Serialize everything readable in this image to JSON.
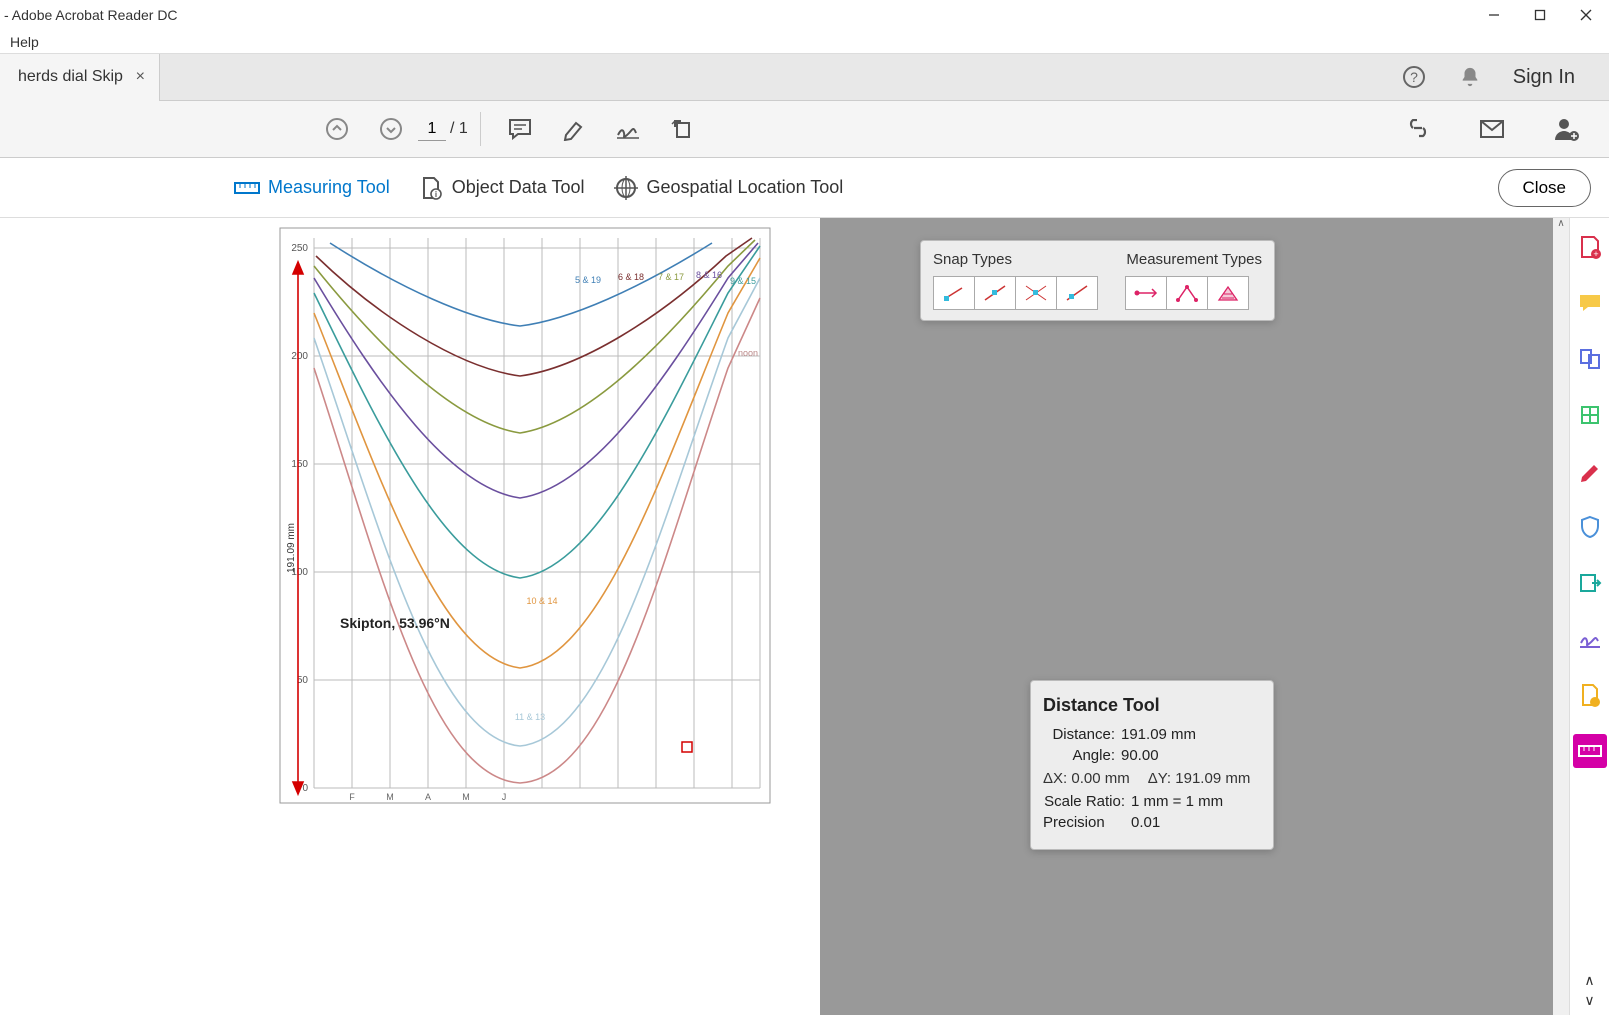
{
  "titlebar": {
    "title": "- Adobe Acrobat Reader DC"
  },
  "menubar": {
    "help": "Help"
  },
  "tab": {
    "title": "herds dial Skip..."
  },
  "header": {
    "signin": "Sign In"
  },
  "pagenav": {
    "current": "1",
    "total": "/  1"
  },
  "subtoolbar": {
    "measuring": "Measuring Tool",
    "objectdata": "Object Data Tool",
    "geospatial": "Geospatial Location Tool",
    "close": "Close"
  },
  "chart_data": {
    "type": "line",
    "title": "Skipton, 53.96°N",
    "ylim": [
      0,
      250
    ],
    "yticks": [
      0,
      50,
      100,
      150,
      200,
      250
    ],
    "xticks": [
      "",
      "",
      "",
      "F",
      "",
      "M",
      "",
      "A",
      "",
      "M",
      "",
      "J",
      ""
    ],
    "annotations": [
      "5 & 19",
      "6 & 18",
      "7 & 17",
      "8 & 16",
      "9 & 15",
      "noon",
      "10 & 14",
      "11 & 13"
    ],
    "measure_label": "191.09 mm"
  },
  "snap_panel": {
    "snap_label": "Snap Types",
    "meas_label": "Measurement Types"
  },
  "dist_panel": {
    "title": "Distance Tool",
    "distance_label": "Distance:",
    "distance_value": "191.09 mm",
    "angle_label": "Angle:",
    "angle_value": "90.00",
    "dx_label": "ΔX:",
    "dx_value": "0.00 mm",
    "dy_label": "ΔY:",
    "dy_value": "191.09 mm",
    "scale_label": "Scale Ratio:",
    "scale_value": "1 mm = 1 mm",
    "precision_label": "Precision",
    "precision_value": "0.01"
  }
}
